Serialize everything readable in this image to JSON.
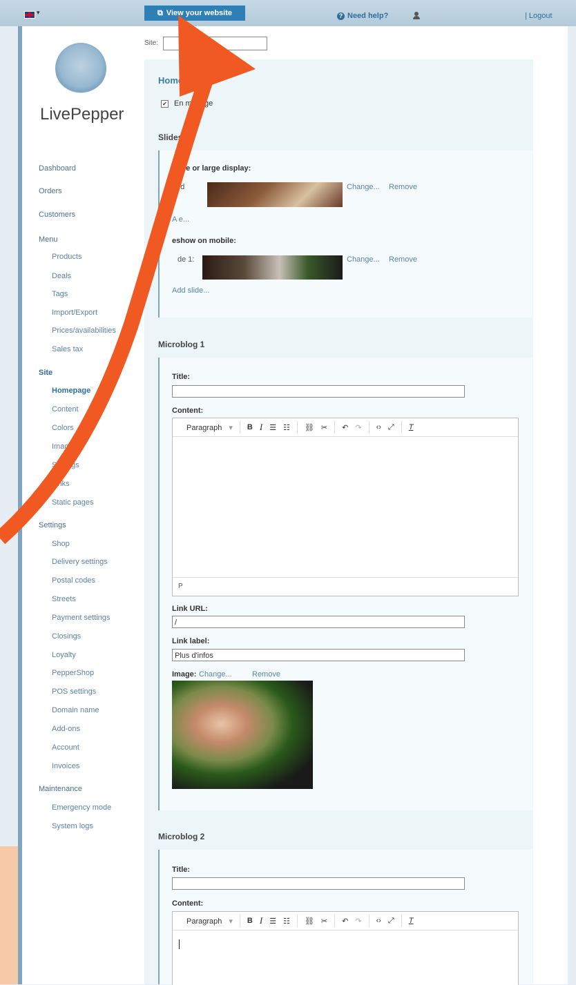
{
  "topbar": {
    "view_site": "View your website",
    "need_help": "Need help?",
    "logout": "| Logout"
  },
  "logo": {
    "text": "LivePepper"
  },
  "site_label": "Site:",
  "nav": [
    {
      "label": "Dashboard",
      "level": 0
    },
    {
      "label": "Orders",
      "level": 0
    },
    {
      "label": "Customers",
      "level": 0
    },
    {
      "label": "Menu",
      "level": 0
    },
    {
      "label": "Products",
      "level": 1
    },
    {
      "label": "Deals",
      "level": 1
    },
    {
      "label": "Tags",
      "level": 1
    },
    {
      "label": "Import/Export",
      "level": 1
    },
    {
      "label": "Prices/availabilities",
      "level": 1
    },
    {
      "label": "Sales tax",
      "level": 1
    },
    {
      "label": "Site",
      "level": 0,
      "active": true
    },
    {
      "label": "Homepage",
      "level": 1,
      "active": true
    },
    {
      "label": "Content",
      "level": 1
    },
    {
      "label": "Colors",
      "level": 1
    },
    {
      "label": "Images",
      "level": 1
    },
    {
      "label": "Settings",
      "level": 1
    },
    {
      "label": "Links",
      "level": 1
    },
    {
      "label": "Static pages",
      "level": 1
    },
    {
      "label": "Settings",
      "level": 0
    },
    {
      "label": "Shop",
      "level": 1
    },
    {
      "label": "Delivery settings",
      "level": 1
    },
    {
      "label": "Postal codes",
      "level": 1
    },
    {
      "label": "Streets",
      "level": 1
    },
    {
      "label": "Payment settings",
      "level": 1
    },
    {
      "label": "Closings",
      "level": 1
    },
    {
      "label": "Loyalty",
      "level": 1
    },
    {
      "label": "PepperShop",
      "level": 1
    },
    {
      "label": "POS settings",
      "level": 1
    },
    {
      "label": "Domain name",
      "level": 1
    },
    {
      "label": "Add-ons",
      "level": 1
    },
    {
      "label": "Account",
      "level": 1
    },
    {
      "label": "Invoices",
      "level": 1
    },
    {
      "label": "Maintenance",
      "level": 0
    },
    {
      "label": "Emergency mode",
      "level": 1
    },
    {
      "label": "System logs",
      "level": 1
    }
  ],
  "homepage": {
    "title": "Home",
    "enable_label": "En      mepage"
  },
  "slideshow": {
    "title": "Slidesho",
    "large_label": "Slide       or large display:",
    "slide_large": "Slid",
    "mobile_label": "   eshow on mobile:",
    "slide_mobile": "de 1:",
    "change": "Change...",
    "remove": "Remove",
    "add_slide_partial": "A       e...",
    "add_slide": "Add slide..."
  },
  "microblog1": {
    "title": "Microblog 1",
    "title_label": "Title:",
    "title_value": "",
    "content_label": "Content:",
    "paragraph": "Paragraph",
    "status": "P",
    "link_url_label": "Link URL:",
    "link_url_value": "/",
    "link_label_label": "Link label:",
    "link_label_value": "Plus d'infos",
    "image_label": "Image:",
    "change": "Change...",
    "remove": "Remove"
  },
  "microblog2": {
    "title": "Microblog 2",
    "title_label": "Title:",
    "content_label": "Content:",
    "paragraph": "Paragraph"
  },
  "toolbar_icons": [
    "bold-icon",
    "italic-icon",
    "ordered-list-icon",
    "bullet-list-icon",
    "link-icon",
    "unlink-icon",
    "undo-icon",
    "redo-icon",
    "code-icon",
    "fullscreen-icon",
    "clear-format-icon"
  ],
  "colors": {
    "accent": "#2f7fb7",
    "arrow": "#f05a22",
    "sidebar_border": "#7ea4c0"
  }
}
